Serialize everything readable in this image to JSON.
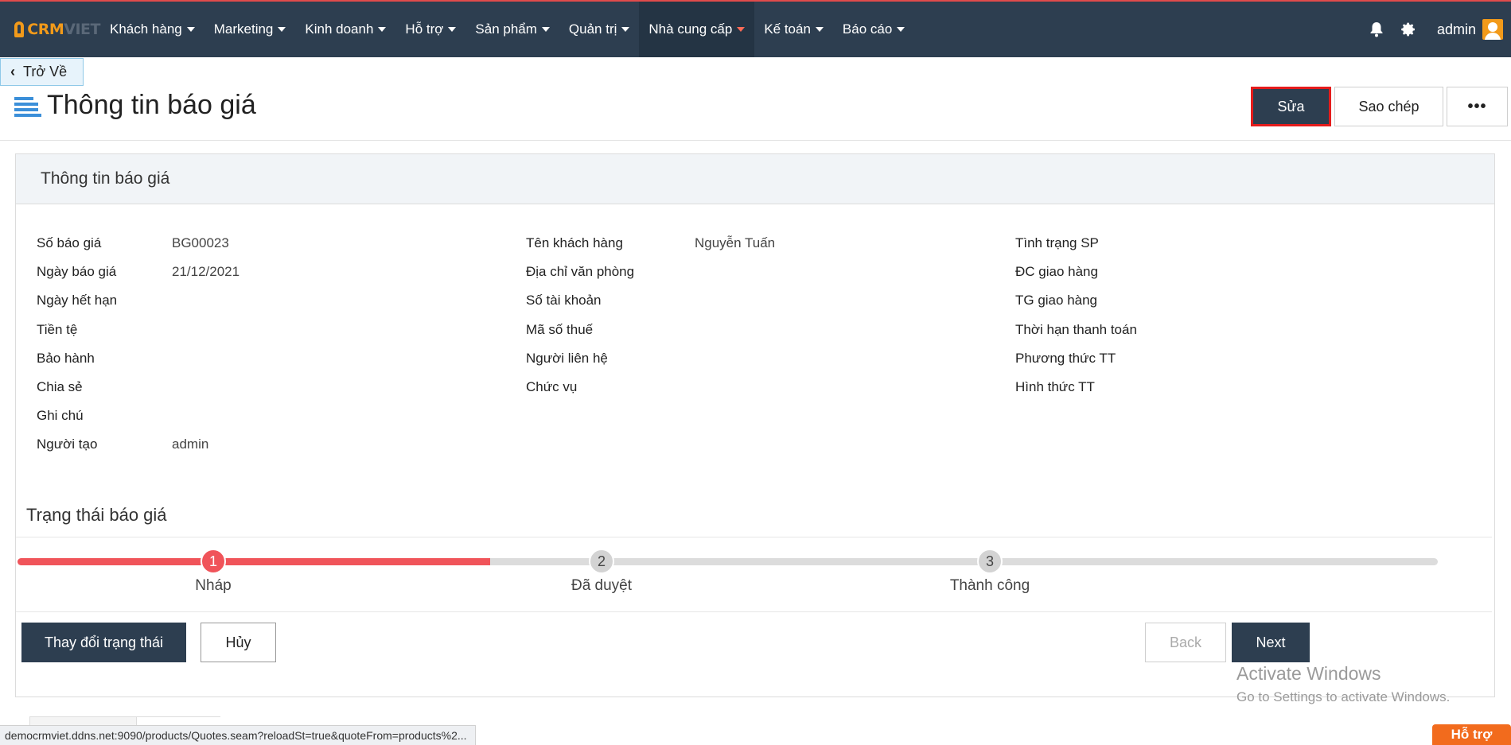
{
  "brand": {
    "logo_main": "CRM",
    "logo_sub": "VIET"
  },
  "nav": {
    "items": [
      {
        "label": "Khách hàng"
      },
      {
        "label": "Marketing"
      },
      {
        "label": "Kinh doanh"
      },
      {
        "label": "Hỗ trợ"
      },
      {
        "label": "Sản phẩm"
      },
      {
        "label": "Quản trị"
      },
      {
        "label": "Nhà cung cấp"
      },
      {
        "label": "Kế toán"
      },
      {
        "label": "Báo cáo"
      }
    ],
    "active_index": 6,
    "user": "admin",
    "icons": [
      "bell-icon",
      "gear-icon",
      "avatar"
    ]
  },
  "back_button": "Trở Về",
  "page": {
    "title": "Thông tin báo giá",
    "buttons": {
      "edit": "Sửa",
      "copy": "Sao chép",
      "more": "•••"
    }
  },
  "panel": {
    "title": "Thông tin báo giá",
    "col1": [
      {
        "label": "Số báo giá",
        "value": "BG00023"
      },
      {
        "label": "Ngày báo giá",
        "value": "21/12/2021"
      },
      {
        "label": "Ngày hết hạn",
        "value": ""
      },
      {
        "label": "Tiền tệ",
        "value": ""
      },
      {
        "label": "Bảo hành",
        "value": ""
      },
      {
        "label": "Chia sẻ",
        "value": ""
      },
      {
        "label": "Ghi chú",
        "value": ""
      },
      {
        "label": "Người tạo",
        "value": "admin"
      }
    ],
    "col2": [
      {
        "label": "Tên khách hàng",
        "value": "Nguyễn Tuấn"
      },
      {
        "label": "Địa chỉ văn phòng",
        "value": ""
      },
      {
        "label": "Số tài khoản",
        "value": ""
      },
      {
        "label": "Mã số thuế",
        "value": ""
      },
      {
        "label": "Người liên hệ",
        "value": ""
      },
      {
        "label": "Chức vụ",
        "value": ""
      }
    ],
    "col3": [
      {
        "label": "Tình trạng SP",
        "value": ""
      },
      {
        "label": "ĐC giao hàng",
        "value": ""
      },
      {
        "label": "TG giao hàng",
        "value": ""
      },
      {
        "label": "Thời hạn thanh toán",
        "value": ""
      },
      {
        "label": "Phương thức TT",
        "value": ""
      },
      {
        "label": "Hình thức TT",
        "value": ""
      }
    ]
  },
  "status": {
    "title": "Trạng thái báo giá",
    "steps": [
      {
        "num": "1",
        "label": "Nháp",
        "done": true
      },
      {
        "num": "2",
        "label": "Đã duyệt",
        "done": false
      },
      {
        "num": "3",
        "label": "Thành công",
        "done": false
      }
    ],
    "progress_fraction": 0.333,
    "buttons": {
      "change": "Thay đổi trạng thái",
      "cancel": "Hủy",
      "back": "Back",
      "next": "Next"
    }
  },
  "watermark": {
    "line1": "Activate Windows",
    "line2": "Go to Settings to activate Windows."
  },
  "status_url": "democrmviet.ddns.net:9090/products/Quotes.seam?reloadSt=true&quoteFrom=products%2...",
  "support": "Hỗ trợ",
  "colors": {
    "nav_bg": "#2d3e50",
    "accent": "#f0545a",
    "brand_orange": "#f29a1a",
    "edit_border": "#e51c1c"
  }
}
